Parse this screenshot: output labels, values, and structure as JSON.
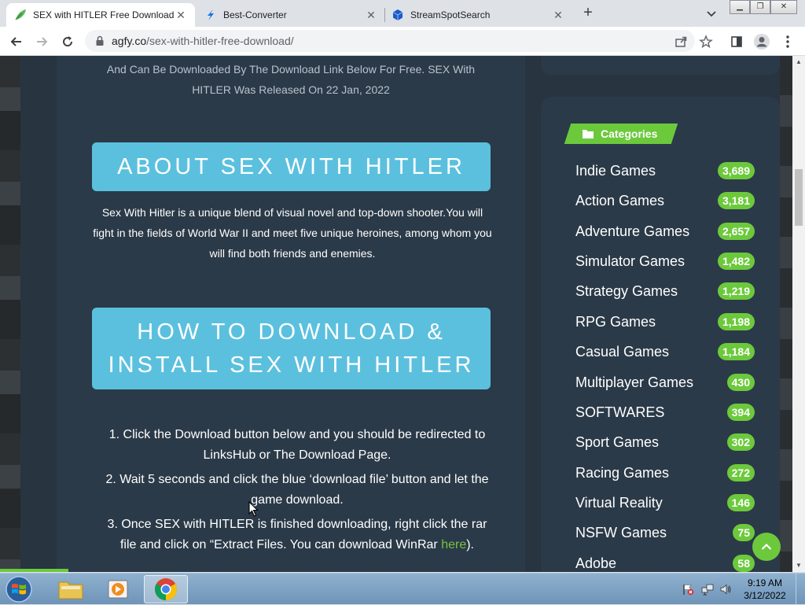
{
  "tabs": [
    {
      "title": "SEX with HITLER Free Download",
      "icon": "leaf-icon",
      "active": true
    },
    {
      "title": "Best-Converter",
      "icon": "bolt-s-icon",
      "active": false
    },
    {
      "title": "StreamSpotSearch",
      "icon": "cube-icon",
      "active": false
    }
  ],
  "toolbar": {
    "url_host": "agfy.co",
    "url_path": "/sex-with-hitler-free-download/"
  },
  "page": {
    "intro": "And Can Be Downloaded By The Download Link Below For Free. SEX With HITLER Was Released On 22 Jan, 2022",
    "about_heading": "ABOUT SEX WITH HITLER",
    "about_text": "Sex With Hitler is a unique blend of visual novel and top-down shooter.You will fight in the fields of World War II and meet five unique heroines, among whom you will find both friends and enemies.",
    "howto_heading": "HOW TO DOWNLOAD & INSTALL SEX WITH HITLER",
    "steps": [
      {
        "text": "1. Click the Download button below and you should be redirected to LinksHub or The Download Page."
      },
      {
        "text": "2. Wait 5 seconds and click the blue ‘download file’ button and let the game download."
      },
      {
        "text": "3. Once SEX with HITLER is finished downloading, right click the rar file and click on “Extract Files. You can download WinRar ",
        "link": "here",
        "after": ")."
      }
    ]
  },
  "sidebar": {
    "categories_title": "Categories",
    "categories": [
      {
        "name": "Indie Games",
        "count": "3,689"
      },
      {
        "name": "Action Games",
        "count": "3,181"
      },
      {
        "name": "Adventure Games",
        "count": "2,657"
      },
      {
        "name": "Simulator Games",
        "count": "1,482"
      },
      {
        "name": "Strategy Games",
        "count": "1,219"
      },
      {
        "name": "RPG Games",
        "count": "1,198"
      },
      {
        "name": "Casual Games",
        "count": "1,184"
      },
      {
        "name": "Multiplayer Games",
        "count": "430"
      },
      {
        "name": "SOFTWARES",
        "count": "394"
      },
      {
        "name": "Sport Games",
        "count": "302"
      },
      {
        "name": "Racing Games",
        "count": "272"
      },
      {
        "name": "Virtual Reality",
        "count": "146"
      },
      {
        "name": "NSFW Games",
        "count": "75"
      },
      {
        "name": "Adobe",
        "count": "58"
      }
    ]
  },
  "taskbar": {
    "time": "9:19 AM",
    "date": "3/12/2022"
  },
  "colors": {
    "accent_green": "#6cc93c",
    "heading_blue": "#5bc0de",
    "panel": "#2b3a48"
  }
}
